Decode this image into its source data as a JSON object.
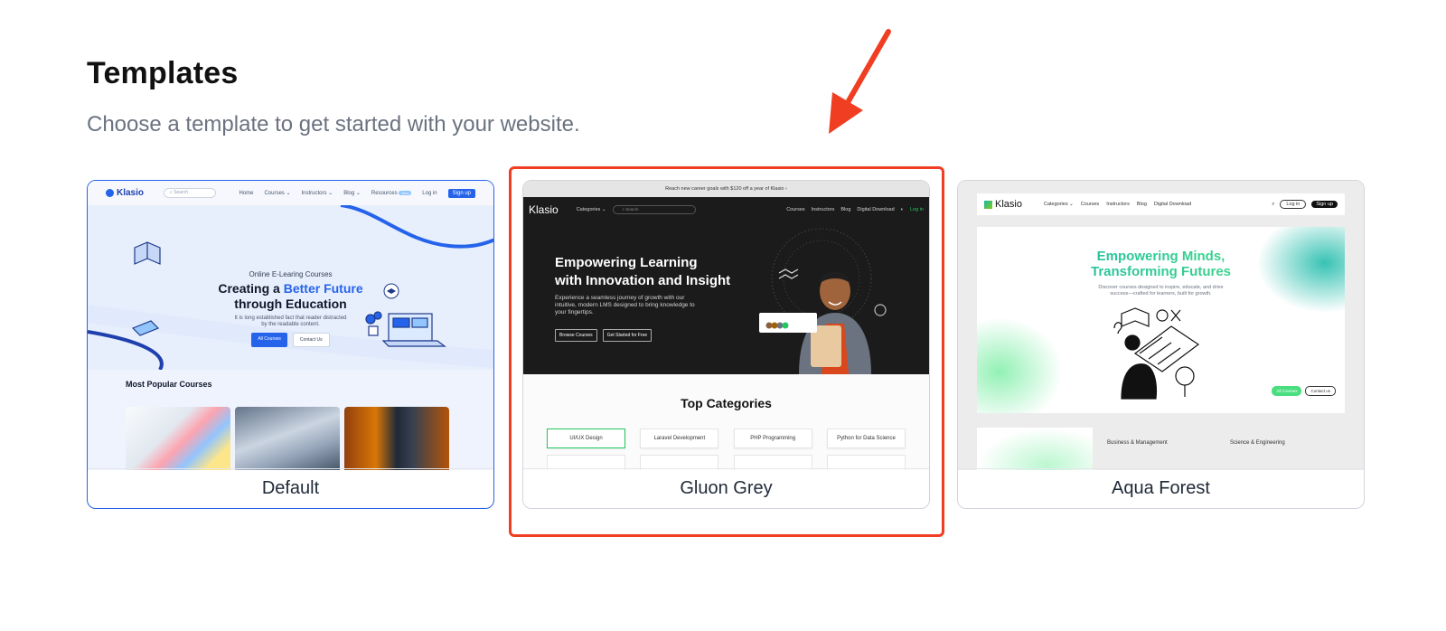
{
  "page": {
    "title": "Templates",
    "subtitle": "Choose a template to get started with your website."
  },
  "templates": [
    {
      "name": "Default",
      "selected": true,
      "preview": {
        "brand": "Klasio",
        "search_placeholder": "Search",
        "nav": [
          "Home",
          "Courses ⌄",
          "Instructors ⌄",
          "Blog ⌄",
          "Resources"
        ],
        "nav_pill": "New",
        "login": "Log in",
        "signup": "Sign up",
        "kicker": "Online E-Learing Courses",
        "headline_1": "Creating a ",
        "headline_accent": "Better Future",
        "headline_2": "through Education",
        "description_1": "It is long established fact that reader distracted",
        "description_2": "by the readable content.",
        "btn_primary": "All Courses",
        "btn_secondary": "Contact Us",
        "section_title": "Most Popular Courses"
      }
    },
    {
      "name": "Gluon Grey",
      "selected": false,
      "preview": {
        "banner": "Reach new career goals with $120 off a year of Klasio  ›",
        "brand": "Klasio",
        "categories": "Categories ⌄",
        "search_placeholder": "Search",
        "nav": [
          "Courses",
          "Instructors",
          "Blog",
          "Digital Download"
        ],
        "login": "Log in",
        "headline_1": "Empowering Learning",
        "headline_2": "with Innovation and Insight",
        "description": "Experience a seamless journey of growth with our intuitive, modern LMS designed to bring knowledge to your fingertips.",
        "btn_1": "Browse Courses",
        "btn_2": "Get Started for Free",
        "section_title": "Top Categories",
        "category_chips": [
          "UI/UX Design",
          "Laravel Development",
          "PHP Programming",
          "Python for Data Science"
        ]
      }
    },
    {
      "name": "Aqua Forest",
      "selected": false,
      "preview": {
        "brand": "Klasio",
        "nav": [
          "Categories ⌄",
          "Courses",
          "Instructors",
          "Blog",
          "Digital Download"
        ],
        "login": "Log in",
        "signup": "Sign up",
        "headline_1": "Empowering Minds,",
        "headline_2": "Transforming Futures",
        "description_1": "Discover courses designed to inspire, educate, and drive",
        "description_2": "success—crafted for learners, built for growth.",
        "btn_1": "All Courses",
        "btn_2": "Contact us",
        "lower_1": "Business & Management",
        "lower_2": "Science & Engineering"
      }
    }
  ],
  "colors": {
    "selected_border": "#2563eb",
    "highlight": "#ef3e22",
    "brand_green": "#22c55e",
    "aqua_gradient_start": "#14b8a6"
  },
  "icons": [
    "search-icon",
    "arrow-annotation-icon"
  ]
}
